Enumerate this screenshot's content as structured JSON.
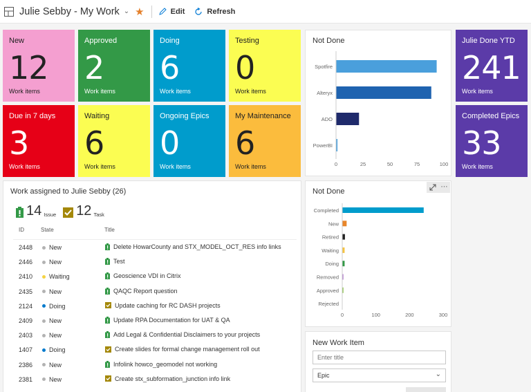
{
  "header": {
    "title": "Julie Sebby - My Work",
    "edit_label": "Edit",
    "refresh_label": "Refresh",
    "icons": [
      "dashboard-grid-icon",
      "chevron-down-icon",
      "star-icon",
      "edit-icon",
      "refresh-icon"
    ]
  },
  "tiles": [
    {
      "label": "New",
      "value": "12",
      "sub": "Work items",
      "color": "#f49fd0"
    },
    {
      "label": "Approved",
      "value": "2",
      "sub": "Work items",
      "color": "#339947"
    },
    {
      "label": "Doing",
      "value": "6",
      "sub": "Work items",
      "color": "#009ccc"
    },
    {
      "label": "Testing",
      "value": "0",
      "sub": "Work items",
      "color": "#fbfd52"
    },
    {
      "label": "Due in 7 days",
      "value": "3",
      "sub": "Work items",
      "color": "#e60017"
    },
    {
      "label": "Waiting",
      "value": "6",
      "sub": "Work items",
      "color": "#fbfd52"
    },
    {
      "label": "Ongoing Epics",
      "value": "0",
      "sub": "Work items",
      "color": "#009ccc"
    },
    {
      "label": "My Maintenance",
      "value": "6",
      "sub": "Work items",
      "color": "#fbbc3d"
    },
    {
      "label": "Julie Done YTD",
      "value": "241",
      "sub": "Work items",
      "color": "#5b3ba8"
    },
    {
      "label": "Completed Epics",
      "value": "33",
      "sub": "Work items",
      "color": "#5b3ba8"
    }
  ],
  "chart1": {
    "title": "Not Done"
  },
  "chart2": {
    "title": "Not Done",
    "icons": [
      "expand-icon",
      "more-options-icon"
    ]
  },
  "chart_data": [
    {
      "type": "bar",
      "orientation": "horizontal",
      "title": "Not Done",
      "categories": [
        "Spotfire",
        "Alteryx",
        "ADO",
        "PowerBI"
      ],
      "values": [
        93,
        88,
        21,
        1
      ],
      "colors": [
        "#4a9fdc",
        "#1f63b0",
        "#1f2a6b",
        "#4a9fdc"
      ],
      "xlim": [
        0,
        100
      ],
      "xticks": [
        "0",
        "25",
        "50",
        "75",
        "100"
      ],
      "grid": false
    },
    {
      "type": "bar",
      "orientation": "horizontal",
      "title": "Not Done",
      "categories": [
        "Completed",
        "New",
        "Retired",
        "Waiting",
        "Doing",
        "Removed",
        "Approved",
        "Rejected"
      ],
      "values": [
        241,
        12,
        7,
        6,
        6,
        2,
        2,
        0
      ],
      "colors": [
        "#009ccc",
        "#e8862a",
        "#222222",
        "#f5c342",
        "#339947",
        "#b57fd0",
        "#8bc34a",
        "#999999"
      ],
      "xlim": [
        0,
        300
      ],
      "xticks": [
        "0",
        "100",
        "200",
        "300"
      ],
      "grid": false
    }
  ],
  "worklist": {
    "title": "Work assigned to Julie Sebby (26)",
    "issue_count": "14",
    "issue_label": "Issue",
    "task_count": "12",
    "task_label": "Task",
    "columns": {
      "id": "ID",
      "state": "State",
      "title": "Title"
    },
    "rows": [
      {
        "id": "2448",
        "state": "New",
        "state_color": "#b2b2b2",
        "type": "issue",
        "title": "Delete HowarCounty and STX_MODEL_OCT_RES info links"
      },
      {
        "id": "2446",
        "state": "New",
        "state_color": "#b2b2b2",
        "type": "issue",
        "title": "Test"
      },
      {
        "id": "2410",
        "state": "Waiting",
        "state_color": "#f5d342",
        "type": "issue",
        "title": "Geoscience VDI in Citrix"
      },
      {
        "id": "2435",
        "state": "New",
        "state_color": "#b2b2b2",
        "type": "issue",
        "title": "QAQC Report question"
      },
      {
        "id": "2124",
        "state": "Doing",
        "state_color": "#007acc",
        "type": "task",
        "title": "Update caching for RC DASH projects"
      },
      {
        "id": "2409",
        "state": "New",
        "state_color": "#b2b2b2",
        "type": "issue",
        "title": "Update RPA Documentation for UAT & QA"
      },
      {
        "id": "2403",
        "state": "New",
        "state_color": "#b2b2b2",
        "type": "issue",
        "title": "Add Legal & Confidential Disclaimers to your projects"
      },
      {
        "id": "1407",
        "state": "Doing",
        "state_color": "#007acc",
        "type": "task",
        "title": "Create slides for formal change management roll out"
      },
      {
        "id": "2386",
        "state": "New",
        "state_color": "#b2b2b2",
        "type": "issue",
        "title": "Infolink howco_geomodel not working"
      },
      {
        "id": "2381",
        "state": "New",
        "state_color": "#b2b2b2",
        "type": "task",
        "title": "Create stx_subformation_junction info link"
      }
    ]
  },
  "new_item": {
    "title": "New Work Item",
    "title_placeholder": "Enter title",
    "type_selected": "Epic"
  }
}
